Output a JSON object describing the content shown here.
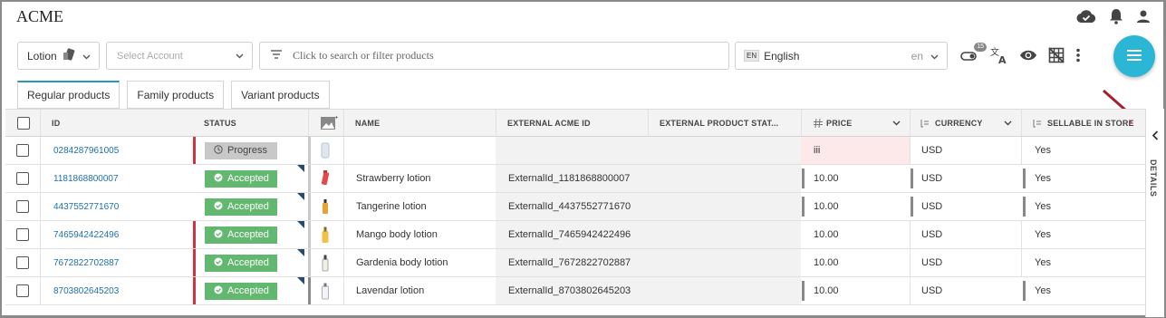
{
  "app": {
    "title": "ACME"
  },
  "toolbar": {
    "catalog_label": "Lotion",
    "account_placeholder": "Select Account",
    "search_placeholder": "Click to search or filter products",
    "language_flag": "EN",
    "language_label": "English",
    "language_code": "en",
    "notifications_badge": "15"
  },
  "tabs": [
    {
      "label": "Regular products",
      "active": true
    },
    {
      "label": "Family products",
      "active": false
    },
    {
      "label": "Variant products",
      "active": false
    }
  ],
  "columns": {
    "id": "ID",
    "status": "STATUS",
    "name": "NAME",
    "external_acme_id": "EXTERNAL ACME ID",
    "external_product_status": "EXTERNAL PRODUCT STAT...",
    "price": "PRICE",
    "currency": "CURRENCY",
    "sellable": "SELLABLE IN STORE"
  },
  "rows": [
    {
      "id": "0284287961005",
      "status": "Progress",
      "name": "",
      "external_id": "",
      "price": "iii",
      "currency": "USD",
      "sellable": "Yes"
    },
    {
      "id": "1181868800007",
      "status": "Accepted",
      "name": "Strawberry lotion",
      "external_id": "ExternalId_1181868800007",
      "price": "10.00",
      "currency": "USD",
      "sellable": "Yes"
    },
    {
      "id": "4437552771670",
      "status": "Accepted",
      "name": "Tangerine lotion",
      "external_id": "ExternalId_4437552771670",
      "price": "10.00",
      "currency": "USD",
      "sellable": "Yes"
    },
    {
      "id": "7465942422496",
      "status": "Accepted",
      "name": "Mango body lotion",
      "external_id": "ExternalId_7465942422496",
      "price": "10.00",
      "currency": "USD",
      "sellable": "Yes"
    },
    {
      "id": "7672822702887",
      "status": "Accepted",
      "name": "Gardenia body lotion",
      "external_id": "ExternalId_7672822702887",
      "price": "10.00",
      "currency": "USD",
      "sellable": "Yes"
    },
    {
      "id": "8703802645203",
      "status": "Accepted",
      "name": "Lavendar lotion",
      "external_id": "ExternalId_8703802645203",
      "price": "10.00",
      "currency": "USD",
      "sellable": "Yes"
    }
  ],
  "details_panel": {
    "label": "DETAILS"
  },
  "colors": {
    "accent": "#2ab6d4",
    "accepted": "#62b86f",
    "progress": "#c8c8c8",
    "error_bar": "#d2323f",
    "link": "#1d6fae",
    "annotation_arrow": "#a3202c"
  }
}
